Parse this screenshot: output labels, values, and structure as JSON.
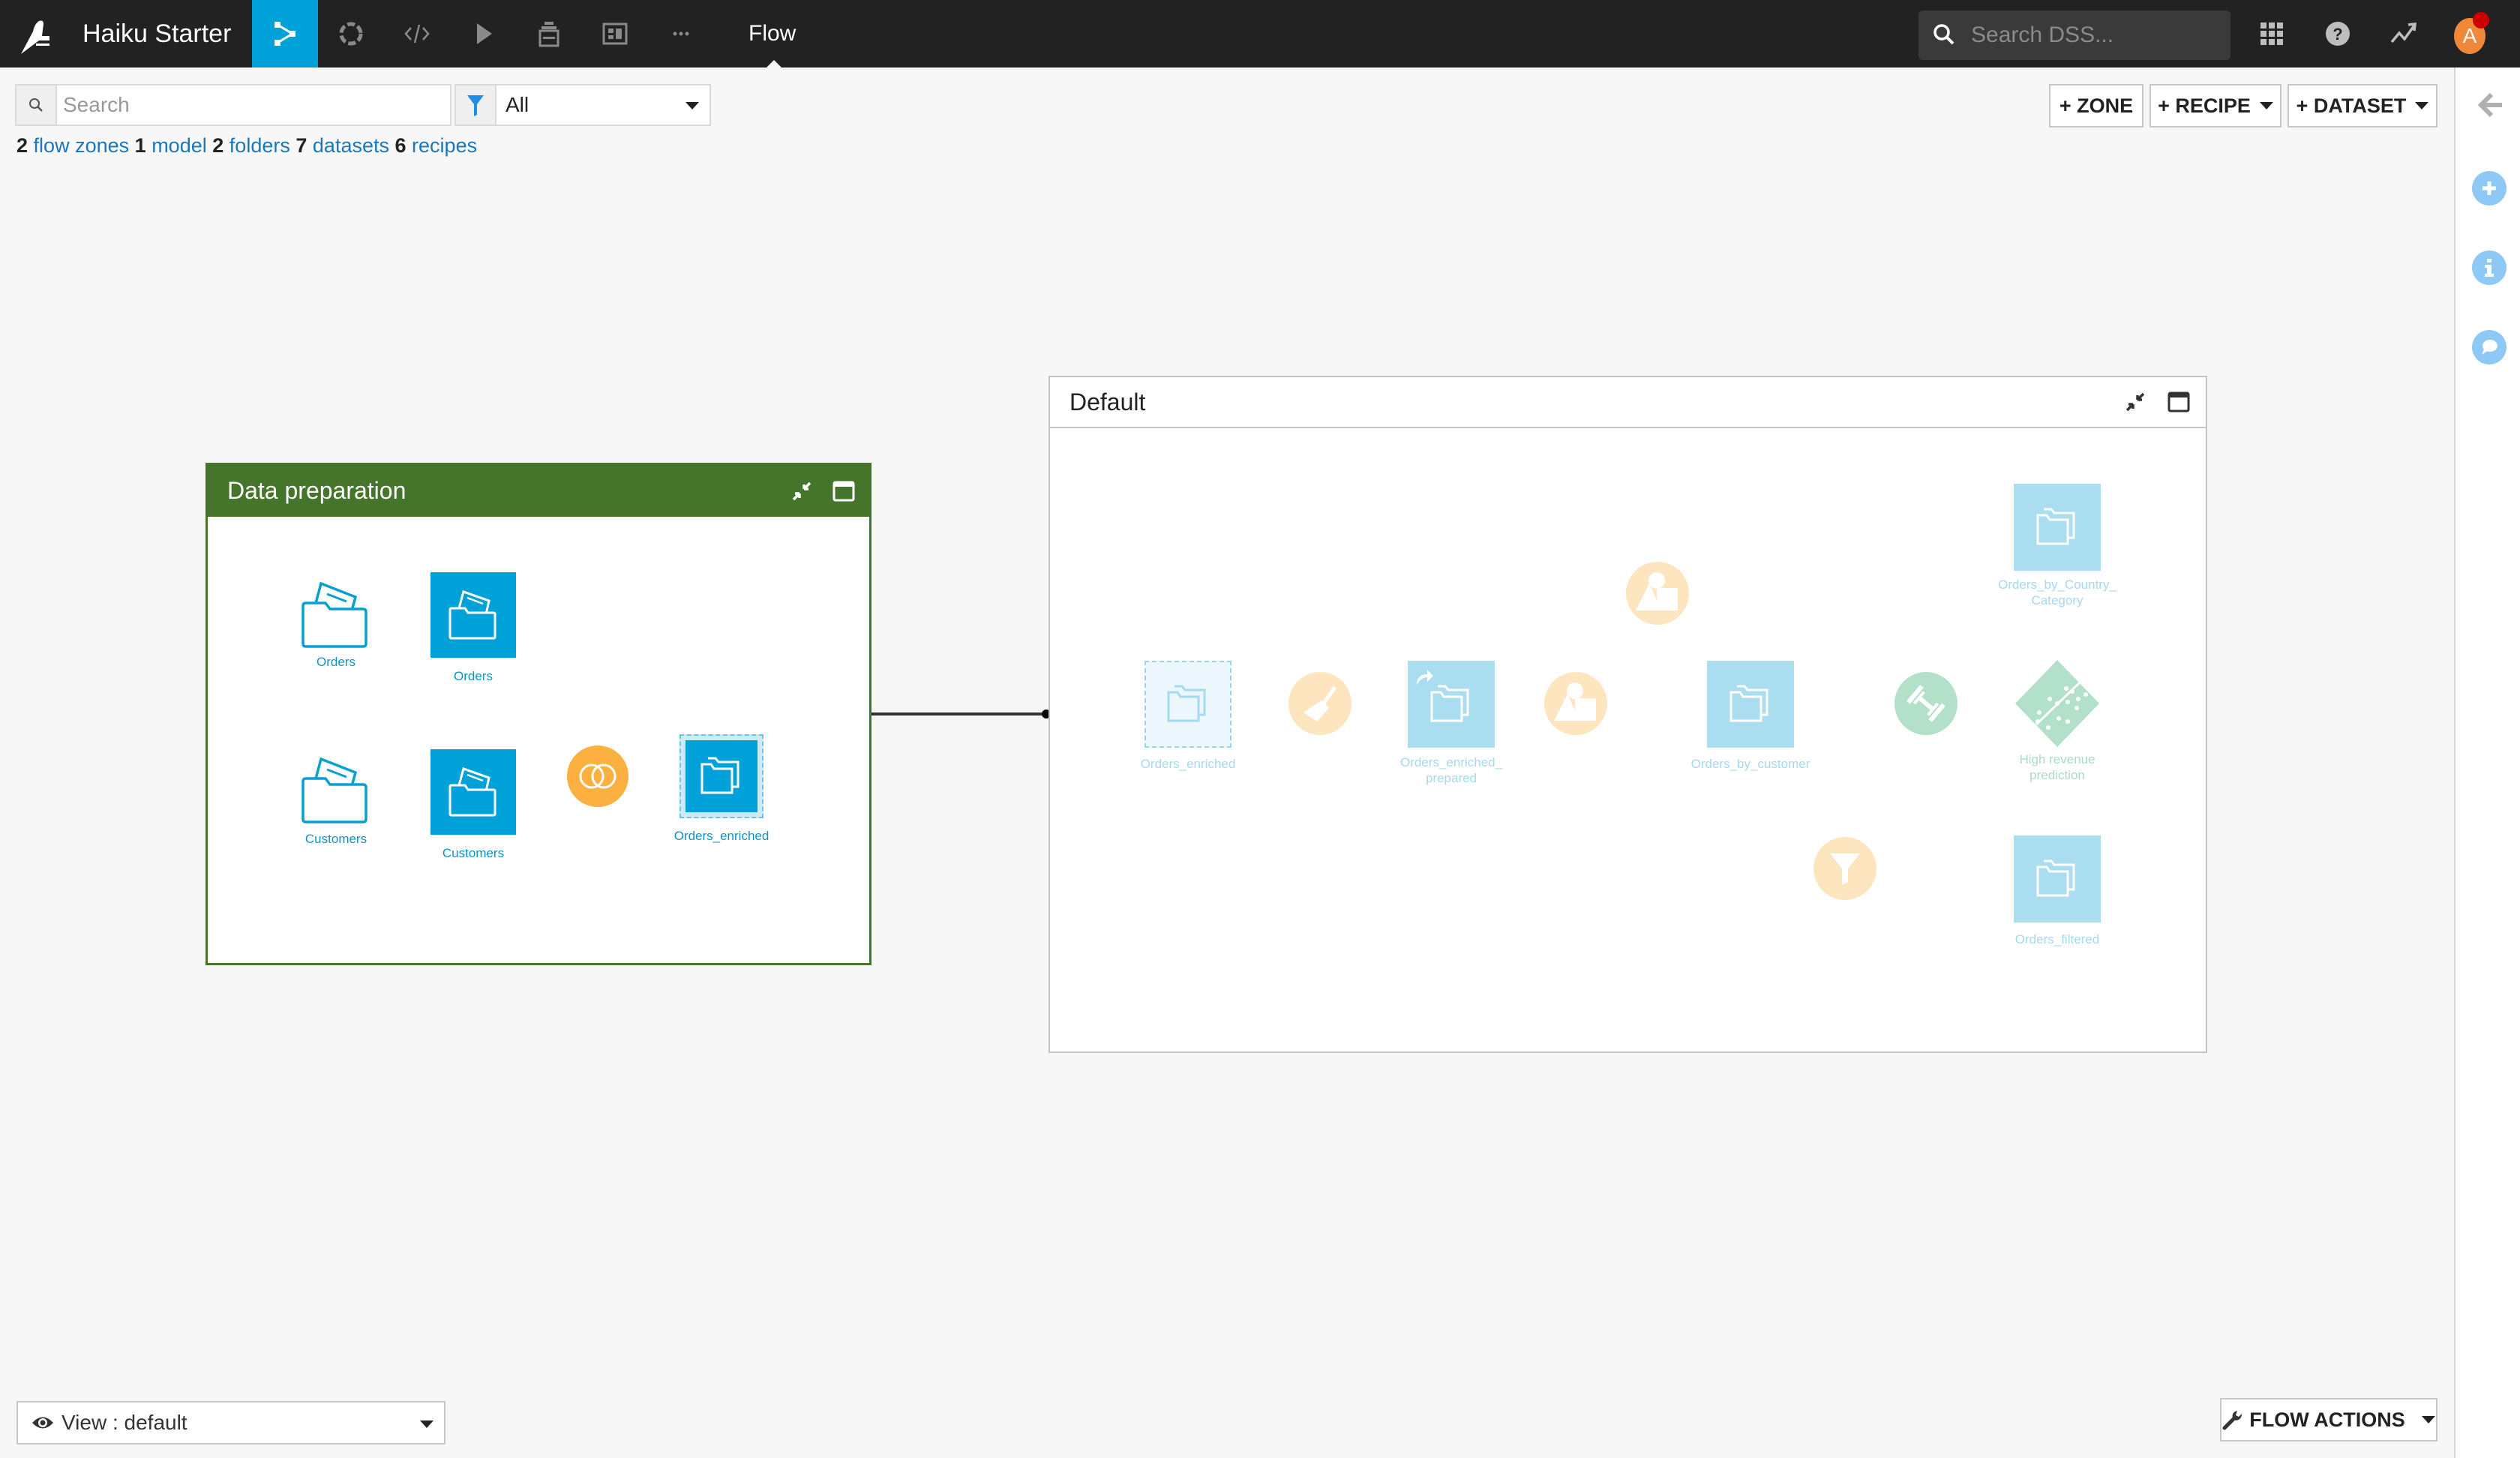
{
  "app": {
    "project_title": "Haiku Starter",
    "page_label": "Flow",
    "nav_icons": [
      "flow-icon",
      "lab-icon",
      "code-icon",
      "run-icon",
      "deploy-icon",
      "dashboard-icon",
      "more-icon"
    ],
    "search_placeholder": "Search DSS...",
    "avatar_initial": "A",
    "colors": {
      "nav_bg": "#222222",
      "accent": "#00a0d8",
      "zone_green": "#44752b",
      "recipe_orange": "#fbb040",
      "model_green": "#b2e0c8"
    }
  },
  "toolbar": {
    "search_placeholder": "Search",
    "filter_value": "All",
    "zone_button": "+ ZONE",
    "recipe_button": "+ RECIPE",
    "dataset_button": "+ DATASET"
  },
  "summary": [
    {
      "count": "2",
      "label": "flow zones"
    },
    {
      "count": "1",
      "label": "model"
    },
    {
      "count": "2",
      "label": "folders"
    },
    {
      "count": "7",
      "label": "datasets"
    },
    {
      "count": "6",
      "label": "recipes"
    }
  ],
  "zones": {
    "data_preparation": {
      "title": "Data preparation",
      "nodes": {
        "orders_folder": "Orders",
        "orders_dataset": "Orders",
        "customers_folder": "Customers",
        "customers_dataset": "Customers",
        "join_recipe": "join",
        "orders_enriched": "Orders_enriched"
      }
    },
    "default": {
      "title": "Default",
      "nodes": {
        "orders_enriched_shared": "Orders_enriched",
        "orders_enriched_prepared_l1": "Orders_enriched_",
        "orders_enriched_prepared_l2": "prepared",
        "orders_by_country_l1": "Orders_by_Country_",
        "orders_by_country_l2": "Category",
        "orders_by_customer": "Orders_by_customer",
        "model_l1": "High revenue",
        "model_l2": "prediction",
        "orders_filtered": "Orders_filtered"
      }
    }
  },
  "bottom": {
    "view_label": "View : default",
    "flow_actions": "FLOW ACTIONS"
  }
}
